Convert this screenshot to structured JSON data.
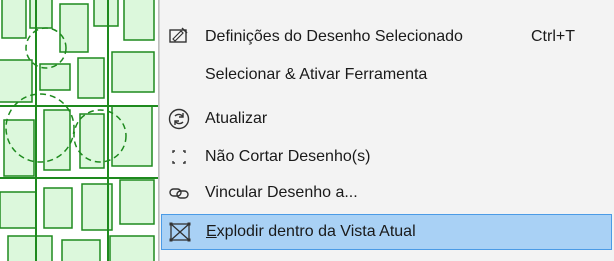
{
  "menu": {
    "items": [
      {
        "label": "Definições do Desenho Selecionado",
        "shortcut": "Ctrl+T",
        "icon": "drawing-settings-icon"
      },
      {
        "label": "Selecionar & Ativar Ferramenta",
        "shortcut": "",
        "icon": ""
      },
      {
        "label": "Atualizar",
        "shortcut": "",
        "icon": "refresh-icon"
      },
      {
        "label": "Não Cortar Desenho(s)",
        "shortcut": "",
        "icon": "crop-corners-icon"
      },
      {
        "label": "Vincular Desenho a...",
        "shortcut": "",
        "icon": "link-icon"
      },
      {
        "label_first": "E",
        "label_rest": "xplodir dentro da Vista Atual",
        "shortcut": "",
        "icon": "explode-icon",
        "highlighted": true
      }
    ]
  },
  "colors": {
    "canvas_line": "#1e8a1e",
    "canvas_fill": "#dcf8dc",
    "menu_bg": "#f3f3f3",
    "highlight_bg": "#a9d1f5",
    "highlight_border": "#4b9be6"
  }
}
